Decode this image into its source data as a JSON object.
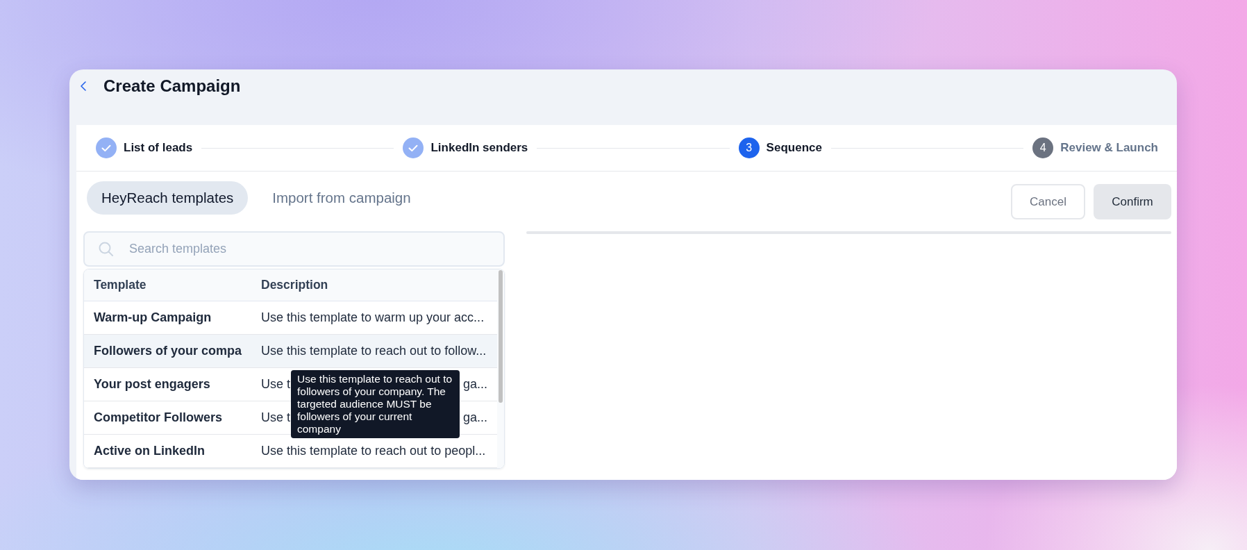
{
  "header": {
    "title": "Create Campaign"
  },
  "steps": [
    {
      "label": "List of leads",
      "kind": "completed"
    },
    {
      "label": "LinkedIn senders",
      "kind": "completed"
    },
    {
      "number": "3",
      "label": "Sequence",
      "kind": "current"
    },
    {
      "number": "4",
      "label": "Review & Launch",
      "kind": "upcoming"
    }
  ],
  "tabs": [
    {
      "label": "HeyReach templates",
      "selected": true
    },
    {
      "label": "Import from campaign",
      "selected": false
    }
  ],
  "buttons": [
    {
      "label": "Cancel",
      "kind": "outline"
    },
    {
      "label": "Confirm",
      "kind": "filled"
    }
  ],
  "search": {
    "placeholder": "Search templates"
  },
  "table": {
    "columns": [
      "Template",
      "Description"
    ],
    "rows": [
      {
        "template": "Warm-up Campaign",
        "description": "Use this template to warm up your acc...",
        "hovered": false
      },
      {
        "template": "Followers of your compa",
        "description": "Use this template to reach out to follow...",
        "hovered": true
      },
      {
        "template": "Your post engagers",
        "description_parts": [
          "Use t",
          "ga..."
        ],
        "hovered": false
      },
      {
        "template": "Competitor Followers",
        "description_parts": [
          "Use t",
          "ga..."
        ],
        "hovered": false
      },
      {
        "template": "Active on LinkedIn",
        "description": "Use this template to reach out to peopl...",
        "hovered": false
      }
    ]
  },
  "tooltip": {
    "text": "Use this template to reach out to followers of your company. The targeted audience MUST be followers of your current company"
  }
}
